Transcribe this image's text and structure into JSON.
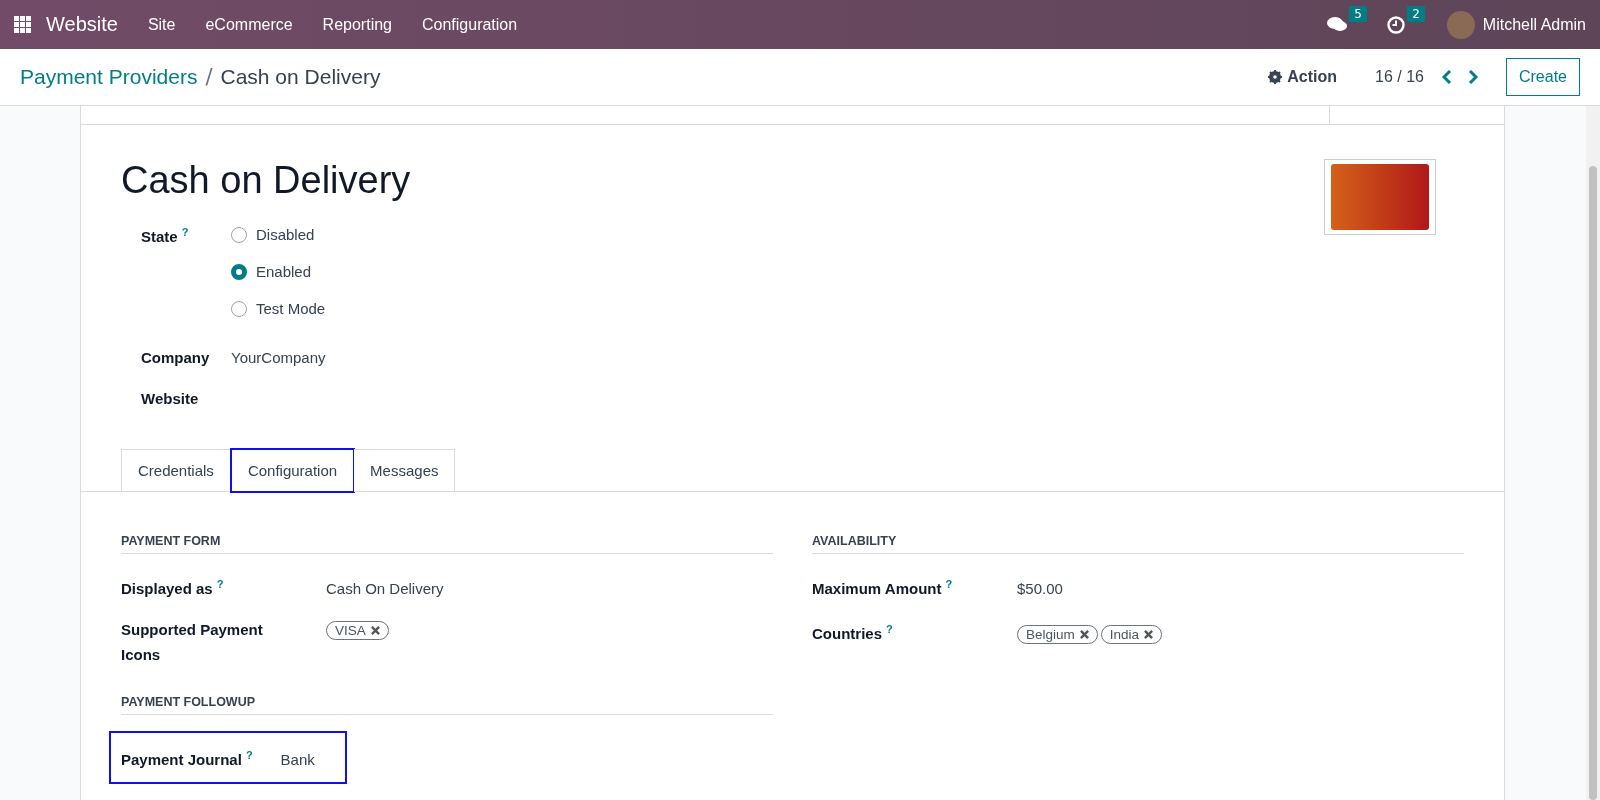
{
  "navbar": {
    "app": "Website",
    "menu": [
      "Site",
      "eCommerce",
      "Reporting",
      "Configuration"
    ],
    "messages_count": "5",
    "activities_count": "2",
    "user": "Mitchell Admin"
  },
  "control_panel": {
    "breadcrumb_parent": "Payment Providers",
    "breadcrumb_separator": "/",
    "breadcrumb_current": "Cash on Delivery",
    "action": "Action",
    "pager": "16 / 16",
    "create": "Create"
  },
  "form": {
    "title": "Cash on Delivery",
    "state_label": "State",
    "state_help": "?",
    "state_options": [
      {
        "label": "Disabled",
        "selected": false
      },
      {
        "label": "Enabled",
        "selected": true
      },
      {
        "label": "Test Mode",
        "selected": false
      }
    ],
    "company_label": "Company",
    "company": "YourCompany",
    "website_label": "Website",
    "tabs": [
      {
        "label": "Credentials",
        "selected": false,
        "highlighted": false
      },
      {
        "label": "Configuration",
        "selected": true,
        "highlighted": true
      },
      {
        "label": "Messages",
        "selected": false,
        "highlighted": false
      }
    ],
    "left_sections": [
      {
        "title": "PAYMENT FORM",
        "fields": [
          {
            "label": "Displayed as",
            "help": "?",
            "kind": "text",
            "value": "Cash On Delivery",
            "highlighted": false
          },
          {
            "label": "Supported Payment Icons",
            "kind": "tags",
            "tags": [
              "VISA"
            ],
            "highlighted": false
          }
        ]
      },
      {
        "title": "PAYMENT FOLLOWUP",
        "fields": [
          {
            "label": "Payment Journal",
            "help": "?",
            "kind": "text",
            "value": "Bank",
            "highlighted": true
          }
        ]
      }
    ],
    "right_sections": [
      {
        "title": "AVAILABILITY",
        "fields": [
          {
            "label": "Maximum Amount",
            "help": "?",
            "kind": "text",
            "value": "$50.00",
            "highlighted": false
          },
          {
            "label": "Countries",
            "help": "?",
            "kind": "tags",
            "tags": [
              "Belgium",
              "India"
            ],
            "highlighted": false
          }
        ]
      }
    ]
  }
}
